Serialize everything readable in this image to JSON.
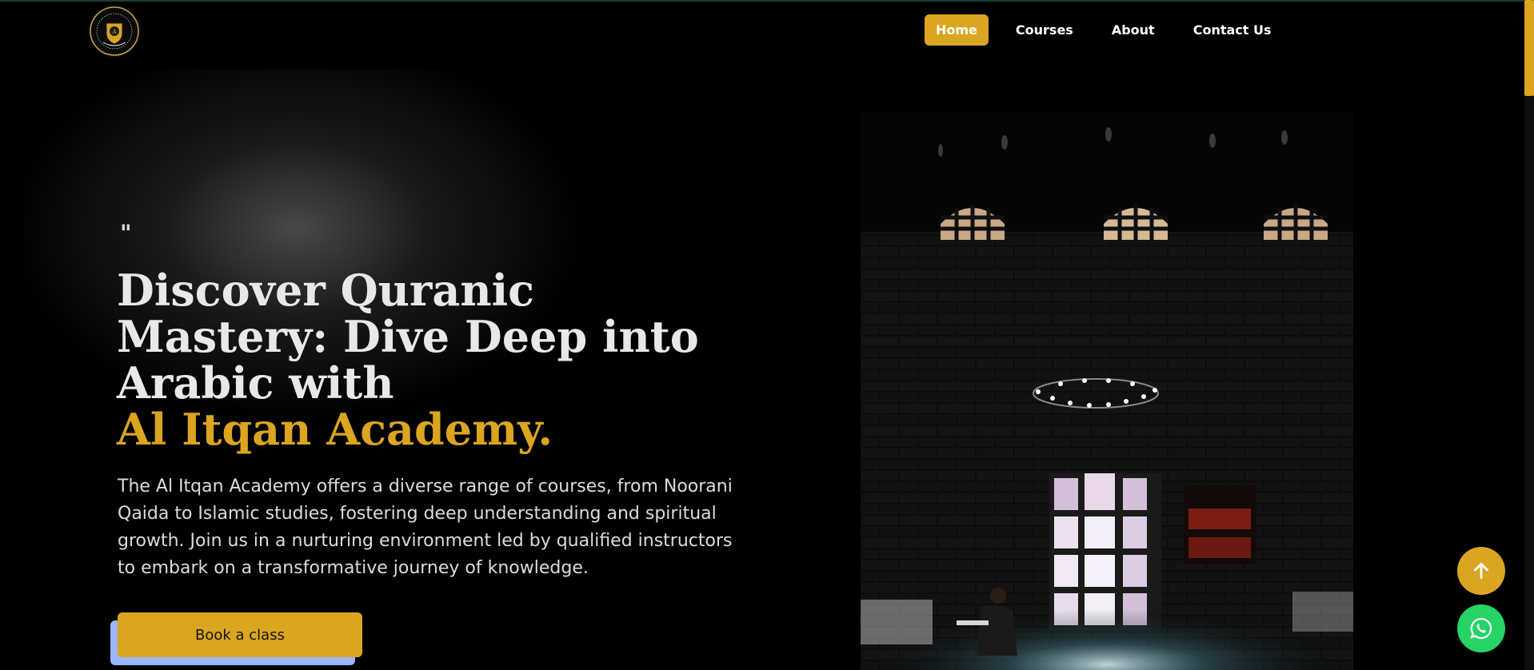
{
  "brand": {
    "logo_icon": "academy-crest-logo",
    "logo_text": "AL ITQAN ACADEMY EST. 2024"
  },
  "nav": {
    "items": [
      {
        "label": "Home",
        "active": true
      },
      {
        "label": "Courses",
        "active": false
      },
      {
        "label": "About",
        "active": false
      },
      {
        "label": "Contact Us",
        "active": false
      }
    ]
  },
  "hero": {
    "quote_mark": "\"",
    "headline_lines": [
      "Discover Quranic",
      "Mastery: Dive Deep into",
      "Arabic with"
    ],
    "headline_accent": "Al Itqan Academy.",
    "description": "The Al Itqan Academy offers a diverse range of courses, from Noorani Qaida to Islamic studies, fostering deep understanding and spiritual growth. Join us in a nurturing environment led by qualified instructors to embark on a transformative journey of knowledge.",
    "cta_label": "Book a class",
    "image_icon": "mosque-interior-photo"
  },
  "floating": {
    "scroll_top_icon": "arrow-up-icon",
    "whatsapp_icon": "whatsapp-icon"
  },
  "colors": {
    "accent": "#daa520",
    "background": "#000000",
    "cta_shadow": "#9bb7ff",
    "whatsapp": "#25d366"
  }
}
